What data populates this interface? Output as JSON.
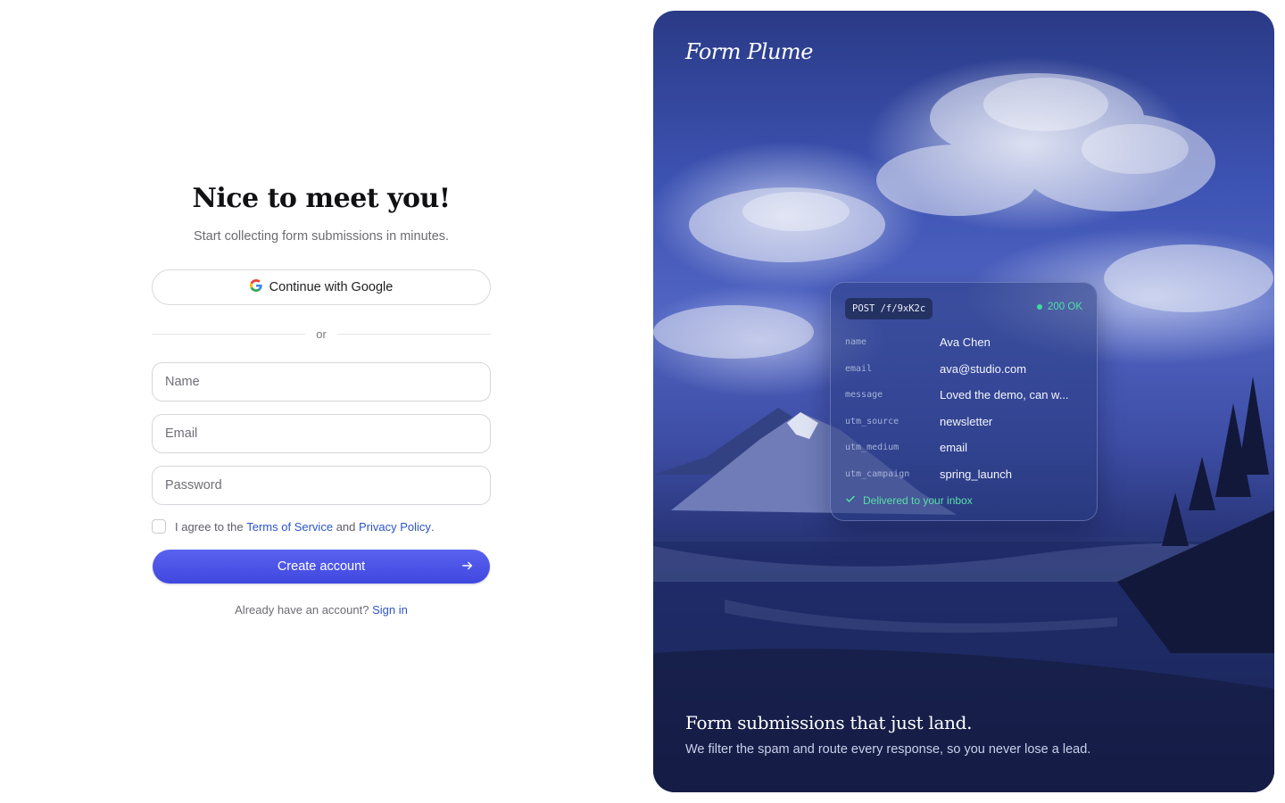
{
  "signup": {
    "title": "Nice to meet you!",
    "subtitle": "Start collecting form submissions in minutes.",
    "google_label": "Continue with Google",
    "divider": "or",
    "name_placeholder": "Name",
    "email_placeholder": "Email",
    "password_placeholder": "Password",
    "agree_prefix": "I agree to the",
    "terms_link": "Terms of Service",
    "agree_and": "and",
    "privacy_link": "Privacy Policy",
    "agree_suffix": ".",
    "create_label": "Create account",
    "signin_prompt": "Already have an account?",
    "signin_link": "Sign in"
  },
  "hero": {
    "brand": "Form Plume",
    "request": "POST /f/9xK2c",
    "status": "200 OK",
    "fields": [
      {
        "key": "name",
        "value": "Ava Chen"
      },
      {
        "key": "email",
        "value": "ava@studio.com"
      },
      {
        "key": "message",
        "value": "Loved the demo, can w..."
      },
      {
        "key": "utm_source",
        "value": "newsletter"
      },
      {
        "key": "utm_medium",
        "value": "email"
      },
      {
        "key": "utm_campaign",
        "value": "spring_launch"
      }
    ],
    "delivered": "Delivered to your inbox",
    "tagline": "Form submissions that just land.",
    "tagline_sub": "We filter the spam and route every response, so you never lose a lead."
  },
  "colors": {
    "primary": "#4a52e8",
    "link": "#2b54c9",
    "success": "#3ddc97"
  },
  "icons": {
    "google": "google-icon",
    "arrow": "arrow-right-icon",
    "check": "check-icon",
    "status_dot": "status-dot-icon"
  }
}
